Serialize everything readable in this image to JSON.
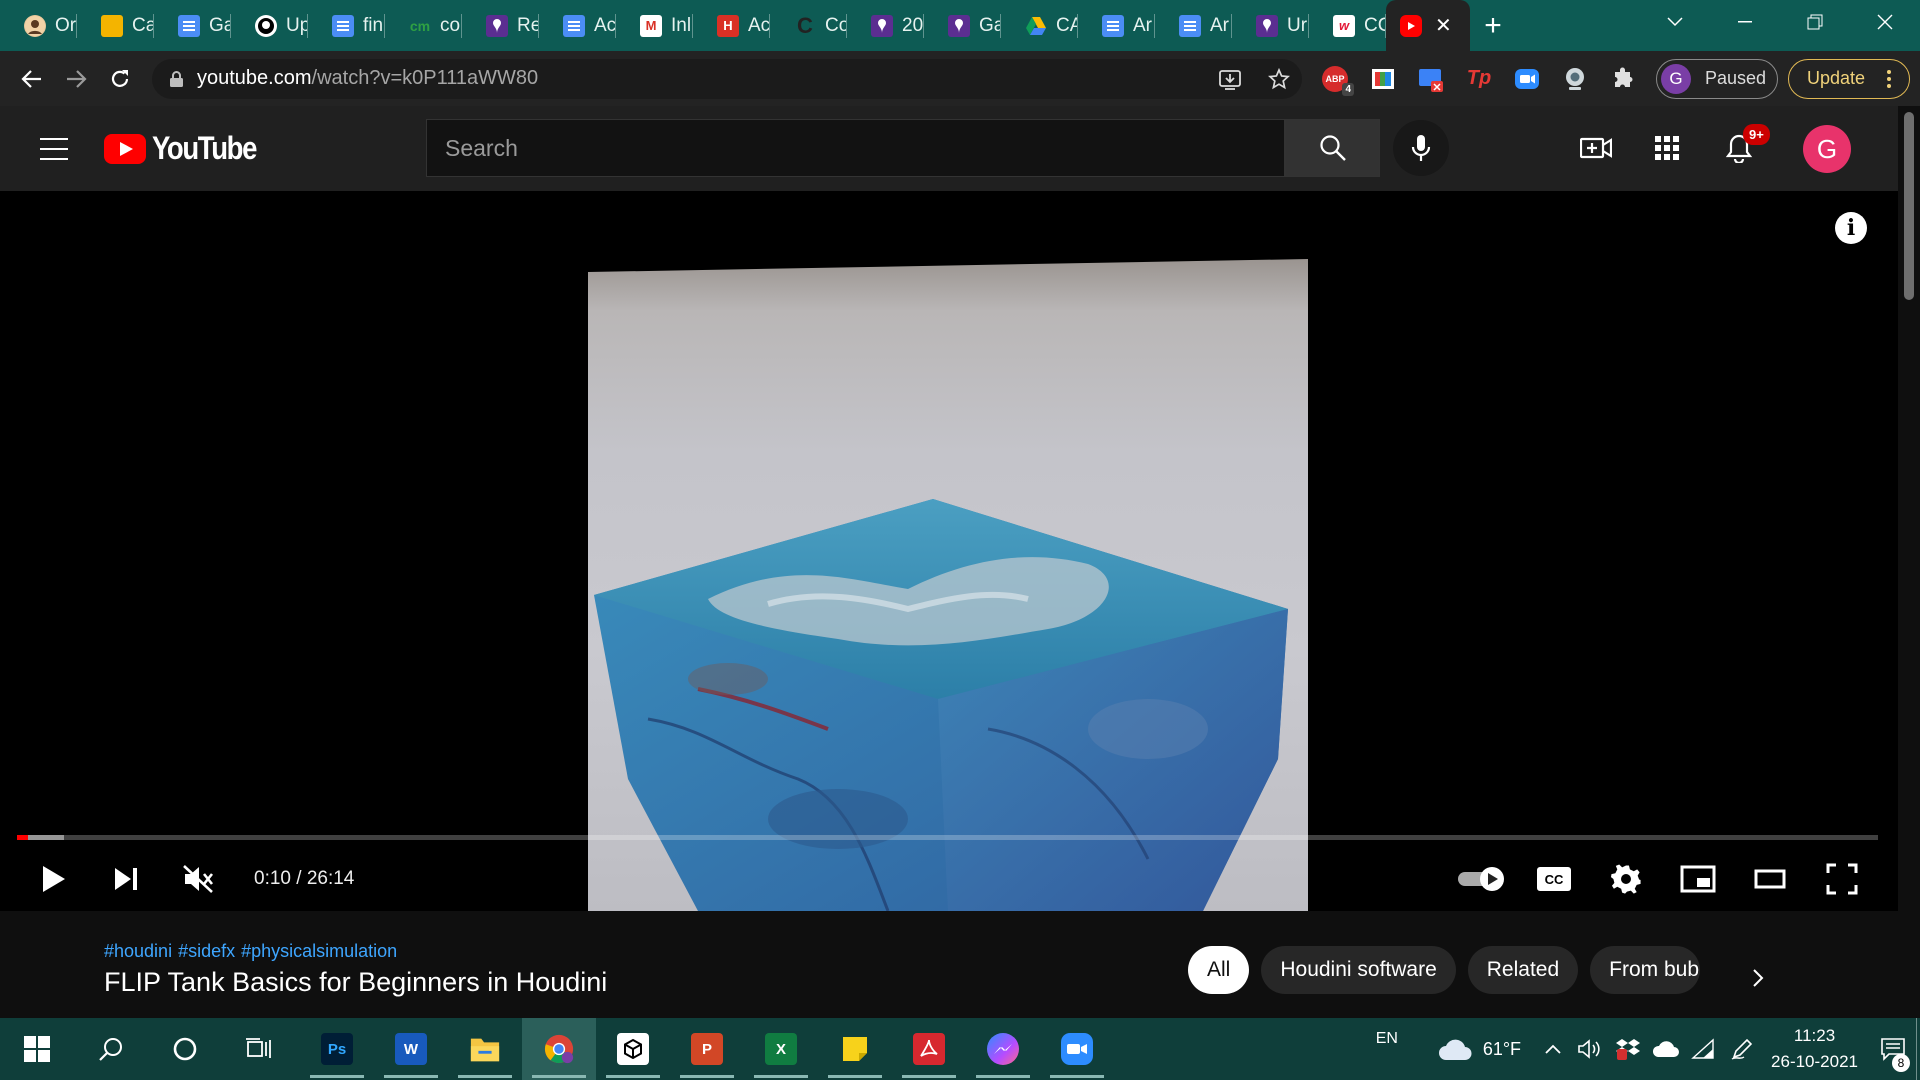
{
  "browser": {
    "tabs": [
      {
        "label": "Or",
        "icon": "avatar-icon"
      },
      {
        "label": "Ca",
        "icon": "google-slides-icon"
      },
      {
        "label": "Ga",
        "icon": "google-docs-icon"
      },
      {
        "label": "Up",
        "icon": "github-icon"
      },
      {
        "label": "fin",
        "icon": "google-docs-icon"
      },
      {
        "label": "co",
        "icon": "cm-icon"
      },
      {
        "label": "Re",
        "icon": "pin-icon"
      },
      {
        "label": "Ac",
        "icon": "google-docs-icon"
      },
      {
        "label": "Inl",
        "icon": "gmail-icon"
      },
      {
        "label": "Ac",
        "icon": "red-app-icon"
      },
      {
        "label": "Co",
        "icon": "c-icon"
      },
      {
        "label": "20",
        "icon": "pin-icon"
      },
      {
        "label": "Ga",
        "icon": "pin-icon"
      },
      {
        "label": "CA",
        "icon": "google-drive-icon"
      },
      {
        "label": "Ar",
        "icon": "google-docs-icon"
      },
      {
        "label": "Ar",
        "icon": "google-docs-icon"
      },
      {
        "label": "Ur",
        "icon": "pin-icon"
      },
      {
        "label": "CC",
        "icon": "walgreens-icon"
      }
    ],
    "active_tab": {
      "icon": "youtube-icon",
      "close": "✕"
    },
    "new_tab": "+",
    "url_host": "youtube.com",
    "url_path": "/watch?v=k0P111aWW80",
    "extensions": {
      "abp_badge": "4",
      "abp_text": "ABP",
      "tp_text": "Tp"
    },
    "profile": {
      "initial": "G",
      "status": "Paused"
    },
    "update_label": "Update"
  },
  "youtube": {
    "logo_text": "YouTube",
    "search_placeholder": "Search",
    "notification_badge": "9+",
    "avatar_initial": "G",
    "player": {
      "current_time": "0:10",
      "duration": "26:14",
      "time_separator": " / ",
      "played_fraction": 0.006,
      "buffered_fraction": 0.025,
      "info": "i",
      "cc": "CC"
    },
    "hashtags": [
      "#houdini",
      "#sidefx",
      "#physicalsimulation"
    ],
    "title": "FLIP Tank Basics for Beginners in Houdini",
    "chips": [
      {
        "label": "All",
        "active": true
      },
      {
        "label": "Houdini software",
        "active": false
      },
      {
        "label": "Related",
        "active": false
      },
      {
        "label": "From bub",
        "active": false
      }
    ]
  },
  "taskbar": {
    "apps": [
      {
        "name": "photoshop",
        "label": "Ps",
        "color": "#001e36",
        "fg": "#31a8ff"
      },
      {
        "name": "word",
        "label": "W",
        "color": "#185abd",
        "fg": "#ffffff"
      },
      {
        "name": "file-explorer",
        "label": "",
        "color": "#f4c542",
        "fg": "#ffffff"
      },
      {
        "name": "chrome",
        "label": "",
        "color": "#ea4335",
        "fg": "#ffffff"
      },
      {
        "name": "unity",
        "label": "",
        "color": "#ffffff",
        "fg": "#000000"
      },
      {
        "name": "powerpoint",
        "label": "P",
        "color": "#d24726",
        "fg": "#ffffff"
      },
      {
        "name": "excel",
        "label": "X",
        "color": "#107c41",
        "fg": "#ffffff"
      },
      {
        "name": "sticky-notes",
        "label": "",
        "color": "#f7d21b",
        "fg": "#000000"
      },
      {
        "name": "acrobat",
        "label": "",
        "color": "#d7282f",
        "fg": "#ffffff"
      },
      {
        "name": "messenger",
        "label": "",
        "color": "#8a4cff",
        "fg": "#ffffff"
      },
      {
        "name": "zoom",
        "label": "",
        "color": "#2d8cff",
        "fg": "#ffffff"
      }
    ],
    "language": "EN",
    "weather": "61°F",
    "time": "11:23",
    "date": "26-10-2021",
    "notification_count": "8"
  },
  "colors": {
    "tabstrip": "#0d5b54",
    "taskbar": "#0f3e3a",
    "youtube_red": "#ff0000",
    "link_blue": "#3ea6ff"
  }
}
